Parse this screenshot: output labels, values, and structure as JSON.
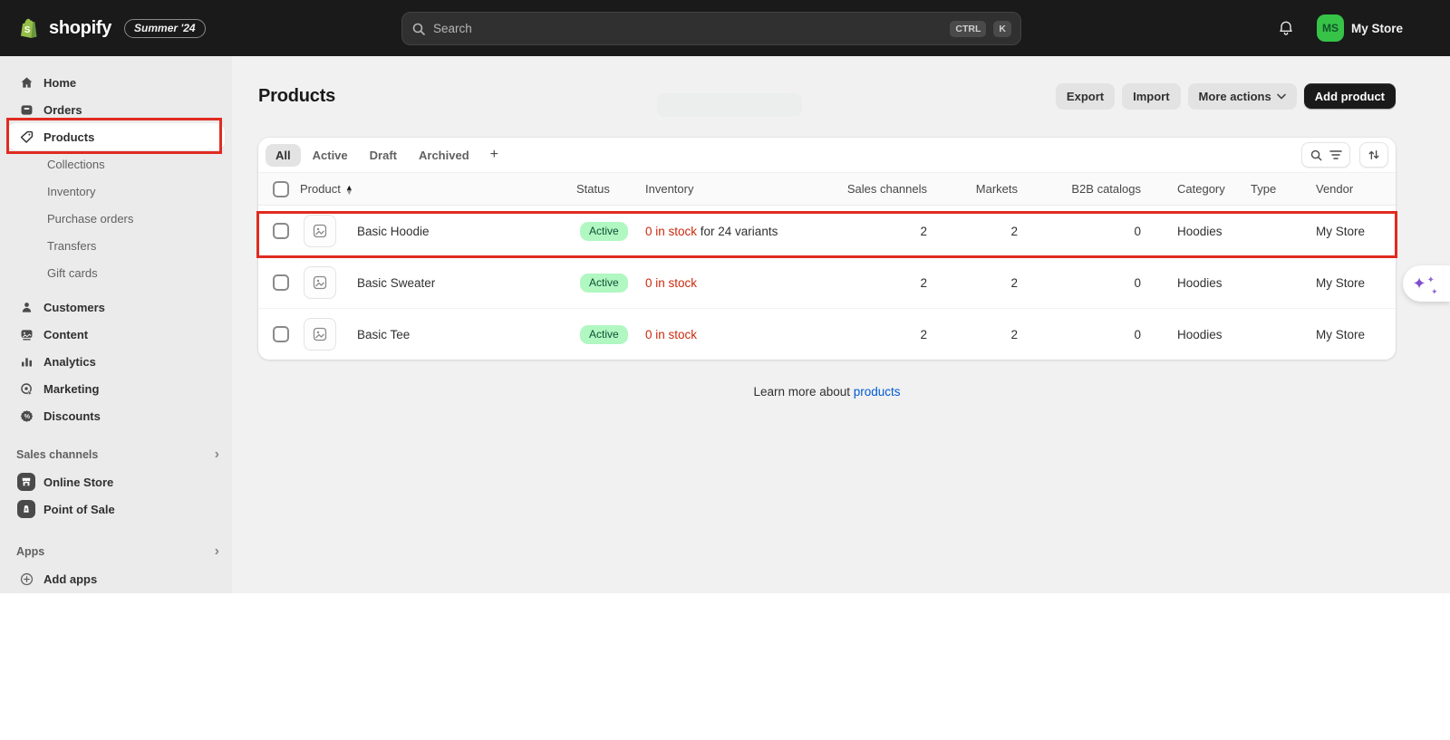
{
  "topbar": {
    "brand": "shopify",
    "version_badge": "Summer '24",
    "search_placeholder": "Search",
    "kbd_ctrl": "CTRL",
    "kbd_k": "K",
    "store_initials": "MS",
    "store_name": "My Store"
  },
  "sidebar": {
    "home": "Home",
    "orders": "Orders",
    "products": "Products",
    "collections": "Collections",
    "inventory": "Inventory",
    "purchase_orders": "Purchase orders",
    "transfers": "Transfers",
    "gift_cards": "Gift cards",
    "customers": "Customers",
    "content": "Content",
    "analytics": "Analytics",
    "marketing": "Marketing",
    "discounts": "Discounts",
    "sales_channels_label": "Sales channels",
    "online_store": "Online Store",
    "point_of_sale": "Point of Sale",
    "apps_label": "Apps",
    "add_apps": "Add apps"
  },
  "page": {
    "title": "Products",
    "export": "Export",
    "import": "Import",
    "more_actions": "More actions",
    "add_product": "Add product"
  },
  "tabs": {
    "all": "All",
    "active": "Active",
    "draft": "Draft",
    "archived": "Archived",
    "add": "+"
  },
  "table": {
    "headers": {
      "product": "Product",
      "status": "Status",
      "inventory": "Inventory",
      "sales_channels": "Sales channels",
      "markets": "Markets",
      "b2b": "B2B catalogs",
      "category": "Category",
      "type": "Type",
      "vendor": "Vendor"
    },
    "rows": [
      {
        "name": "Basic Hoodie",
        "status": "Active",
        "stock": "0 in stock",
        "stock_note": " for 24 variants",
        "sales_channels": "2",
        "markets": "2",
        "b2b": "0",
        "category": "Hoodies",
        "type": "",
        "vendor": "My Store"
      },
      {
        "name": "Basic Sweater",
        "status": "Active",
        "stock": "0 in stock",
        "stock_note": "",
        "sales_channels": "2",
        "markets": "2",
        "b2b": "0",
        "category": "Hoodies",
        "type": "",
        "vendor": "My Store"
      },
      {
        "name": "Basic Tee",
        "status": "Active",
        "stock": "0 in stock",
        "stock_note": "",
        "sales_channels": "2",
        "markets": "2",
        "b2b": "0",
        "category": "Hoodies",
        "type": "",
        "vendor": "My Store"
      }
    ]
  },
  "footer": {
    "text": "Learn more about ",
    "link": "products"
  },
  "colors": {
    "topbar_bg": "#1a1a1a",
    "sidebar_bg": "#ebebeb",
    "content_bg": "#f1f1f1",
    "avatar_green": "#36c348",
    "status_badge_bg": "#b1f7c2",
    "status_badge_text": "#0c5132",
    "critical_text": "#cb2a0e",
    "link_blue": "#005bd3",
    "annotation_red": "#e02b20",
    "sidekick_purple": "#7f4fd0"
  }
}
